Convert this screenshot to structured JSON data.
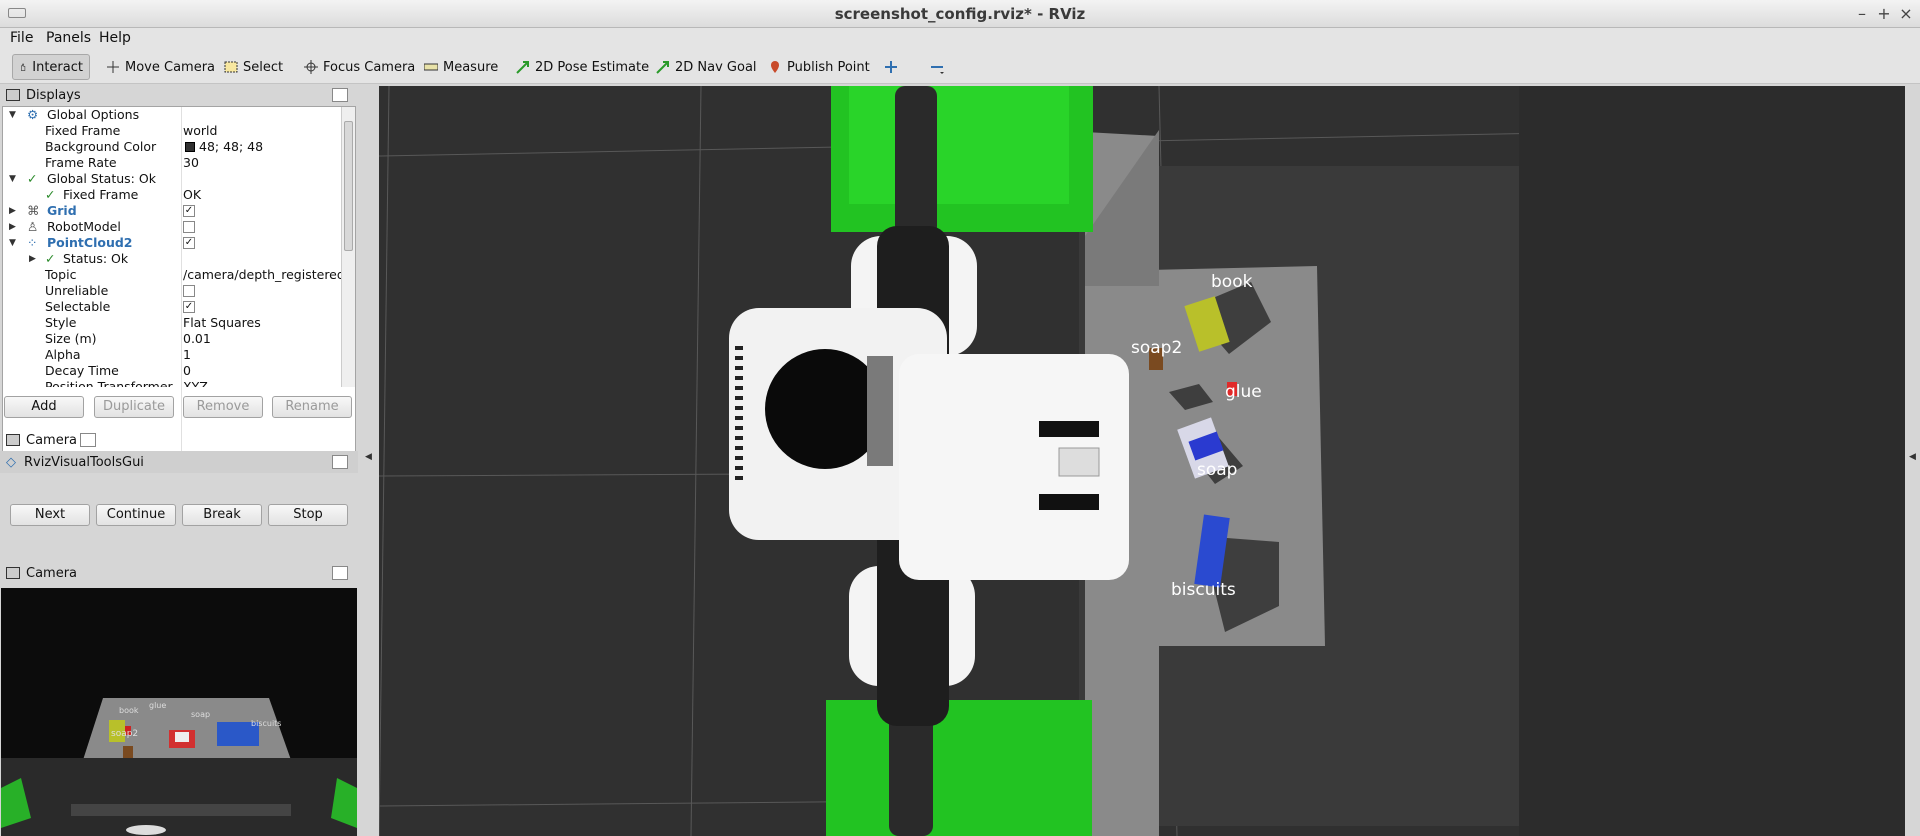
{
  "window": {
    "title": "screenshot_config.rviz* - RViz"
  },
  "menu": {
    "file": "File",
    "panels": "Panels",
    "help": "Help"
  },
  "toolbar": {
    "interact": "Interact",
    "move_camera": "Move Camera",
    "select": "Select",
    "focus_camera": "Focus Camera",
    "measure": "Measure",
    "pose_estimate": "2D Pose Estimate",
    "nav_goal": "2D Nav Goal",
    "publish_point": "Publish Point"
  },
  "displays": {
    "title": "Displays",
    "rows": [
      {
        "key": "Global Options",
        "value": ""
      },
      {
        "key": "Fixed Frame",
        "value": "world"
      },
      {
        "key": "Background Color",
        "value": "48; 48; 48"
      },
      {
        "key": "Frame Rate",
        "value": "30"
      },
      {
        "key": "Global Status: Ok",
        "value": ""
      },
      {
        "key": "Fixed Frame",
        "value": "OK"
      },
      {
        "key": "Grid",
        "value": ""
      },
      {
        "key": "RobotModel",
        "value": ""
      },
      {
        "key": "PointCloud2",
        "value": ""
      },
      {
        "key": "Status: Ok",
        "value": ""
      },
      {
        "key": "Topic",
        "value": "/camera/depth_registered."
      },
      {
        "key": "Unreliable",
        "value": ""
      },
      {
        "key": "Selectable",
        "value": ""
      },
      {
        "key": "Style",
        "value": "Flat Squares"
      },
      {
        "key": "Size (m)",
        "value": "0.01"
      },
      {
        "key": "Alpha",
        "value": "1"
      },
      {
        "key": "Decay Time",
        "value": "0"
      },
      {
        "key": "Position Transformer",
        "value": "XYZ"
      }
    ],
    "buttons": {
      "add": "Add",
      "duplicate": "Duplicate",
      "remove": "Remove",
      "rename": "Rename"
    }
  },
  "camera_panel": {
    "title": "Camera"
  },
  "rviz_visual_tools": {
    "title": "RvizVisualToolsGui",
    "buttons": {
      "next": "Next",
      "continue": "Continue",
      "break": "Break",
      "stop": "Stop"
    }
  },
  "camera_dock": {
    "title": "Camera",
    "labels": {
      "book": "book",
      "glue": "glue",
      "soap": "soap",
      "soap2": "soap2",
      "biscuits": "biscuits"
    }
  },
  "scene": {
    "labels": {
      "book": "book",
      "soap2": "soap2",
      "glue": "glue",
      "soap": "soap",
      "biscuits": "biscuits"
    }
  },
  "colors": {
    "background": "#303030",
    "accent_blue": "#2f6fb0",
    "ok_green": "#2a8a2a",
    "bin_green": "#22c322"
  }
}
